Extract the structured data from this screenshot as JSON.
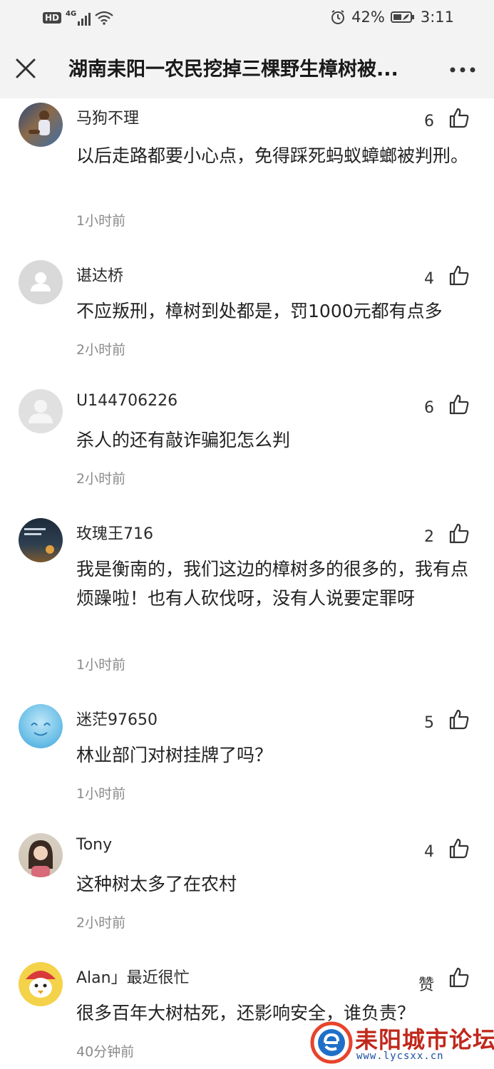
{
  "statusbar": {
    "network": "HD",
    "signal_type": "4G",
    "battery": "42%",
    "time": "3:11"
  },
  "header": {
    "title": "湖南耒阳一农民挖掉三棵野生樟树被..."
  },
  "comments": [
    {
      "user": "马狗不理",
      "likes": "6",
      "text": "以后走路都要小心点，免得踩死蚂蚁蟑螂被判刑。",
      "time": "1小时前"
    },
    {
      "user": "谌达桥",
      "likes": "4",
      "text": "不应叛刑，樟树到处都是，罚1000元都有点多",
      "time": "2小时前"
    },
    {
      "user": "U144706226",
      "likes": "6",
      "text": "杀人的还有敲诈骗犯怎么判",
      "time": "2小时前"
    },
    {
      "user": "玫瑰王716",
      "likes": "2",
      "text": "我是衡南的，我们这边的樟树多的很多的，我有点烦躁啦！也有人砍伐呀，没有人说要定罪呀",
      "time": "1小时前"
    },
    {
      "user": "迷茫97650",
      "likes": "5",
      "text": "林业部门对树挂牌了吗？",
      "time": "1小时前"
    },
    {
      "user": "Tony",
      "likes": "4",
      "text": "这种树太多了在农村",
      "time": "2小时前"
    },
    {
      "user": "Alan」最近很忙",
      "likes": "赞",
      "text": "很多百年大树枯死，还影响安全，谁负责？",
      "time": "40分钟前"
    }
  ],
  "watermark": {
    "text": "耒阳城市论坛",
    "url": "www.lycsxx.cn"
  }
}
